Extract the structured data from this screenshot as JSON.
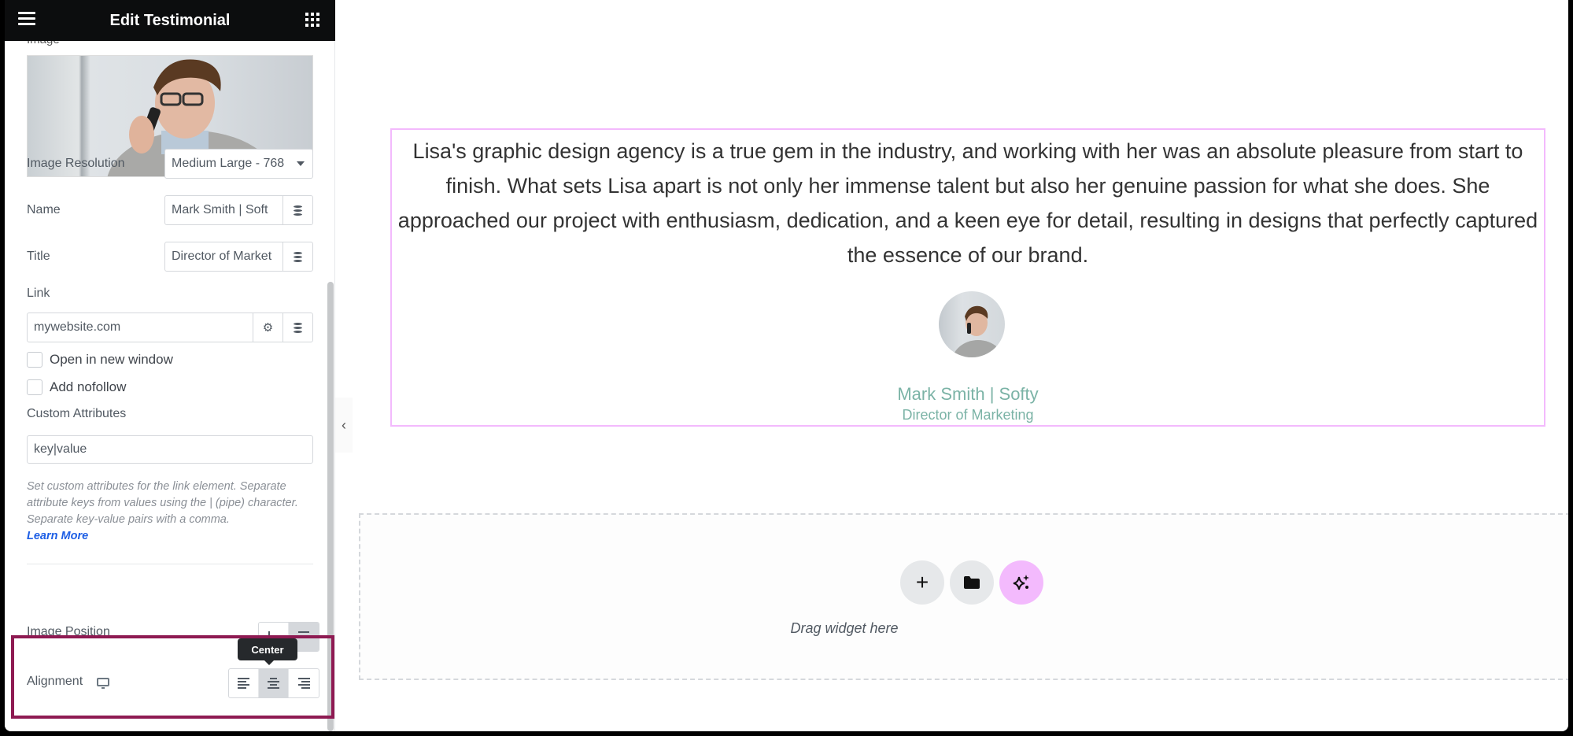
{
  "panel": {
    "title": "Edit Testimonial",
    "cut_label": "Image",
    "image_resolution": {
      "label": "Image Resolution",
      "value": "Medium Large - 768"
    },
    "name": {
      "label": "Name",
      "value": "Mark Smith  | Soft"
    },
    "title_field": {
      "label": "Title",
      "value": "Director of Market"
    },
    "link": {
      "label": "Link",
      "value": "mywebsite.com"
    },
    "open_new_window": {
      "label": "Open in new window",
      "checked": false
    },
    "add_nofollow": {
      "label": "Add nofollow",
      "checked": false
    },
    "custom_attributes": {
      "label": "Custom Attributes",
      "placeholder": "key|value"
    },
    "help_text": "Set custom attributes for the link element. Separate attribute keys from values using the | (pipe) character. Separate key-value pairs with a comma.",
    "learn_more": "Learn More",
    "image_position": {
      "label": "Image Position"
    },
    "alignment": {
      "label": "Alignment",
      "options": [
        "Left",
        "Center",
        "Right"
      ],
      "selected": "Center"
    },
    "tooltip": "Center"
  },
  "canvas": {
    "testimonial": {
      "content": "Lisa's graphic design agency is a true gem in the industry, and working with her was an absolute pleasure from start to finish. What sets Lisa apart is not only her immense talent but also her genuine passion for what she does. She approached our project with enthusiasm, dedication, and a keen eye for detail, resulting in designs that perfectly captured the essence of our brand.",
      "name": "Mark Smith | Softy",
      "job": "Director of Marketing"
    },
    "dropzone": {
      "text": "Drag widget here"
    }
  },
  "colors": {
    "highlight": "#8e1a52",
    "widget_outline": "#f3bafd",
    "name_color": "#7bb3a6",
    "link": "#1d5ee5"
  }
}
